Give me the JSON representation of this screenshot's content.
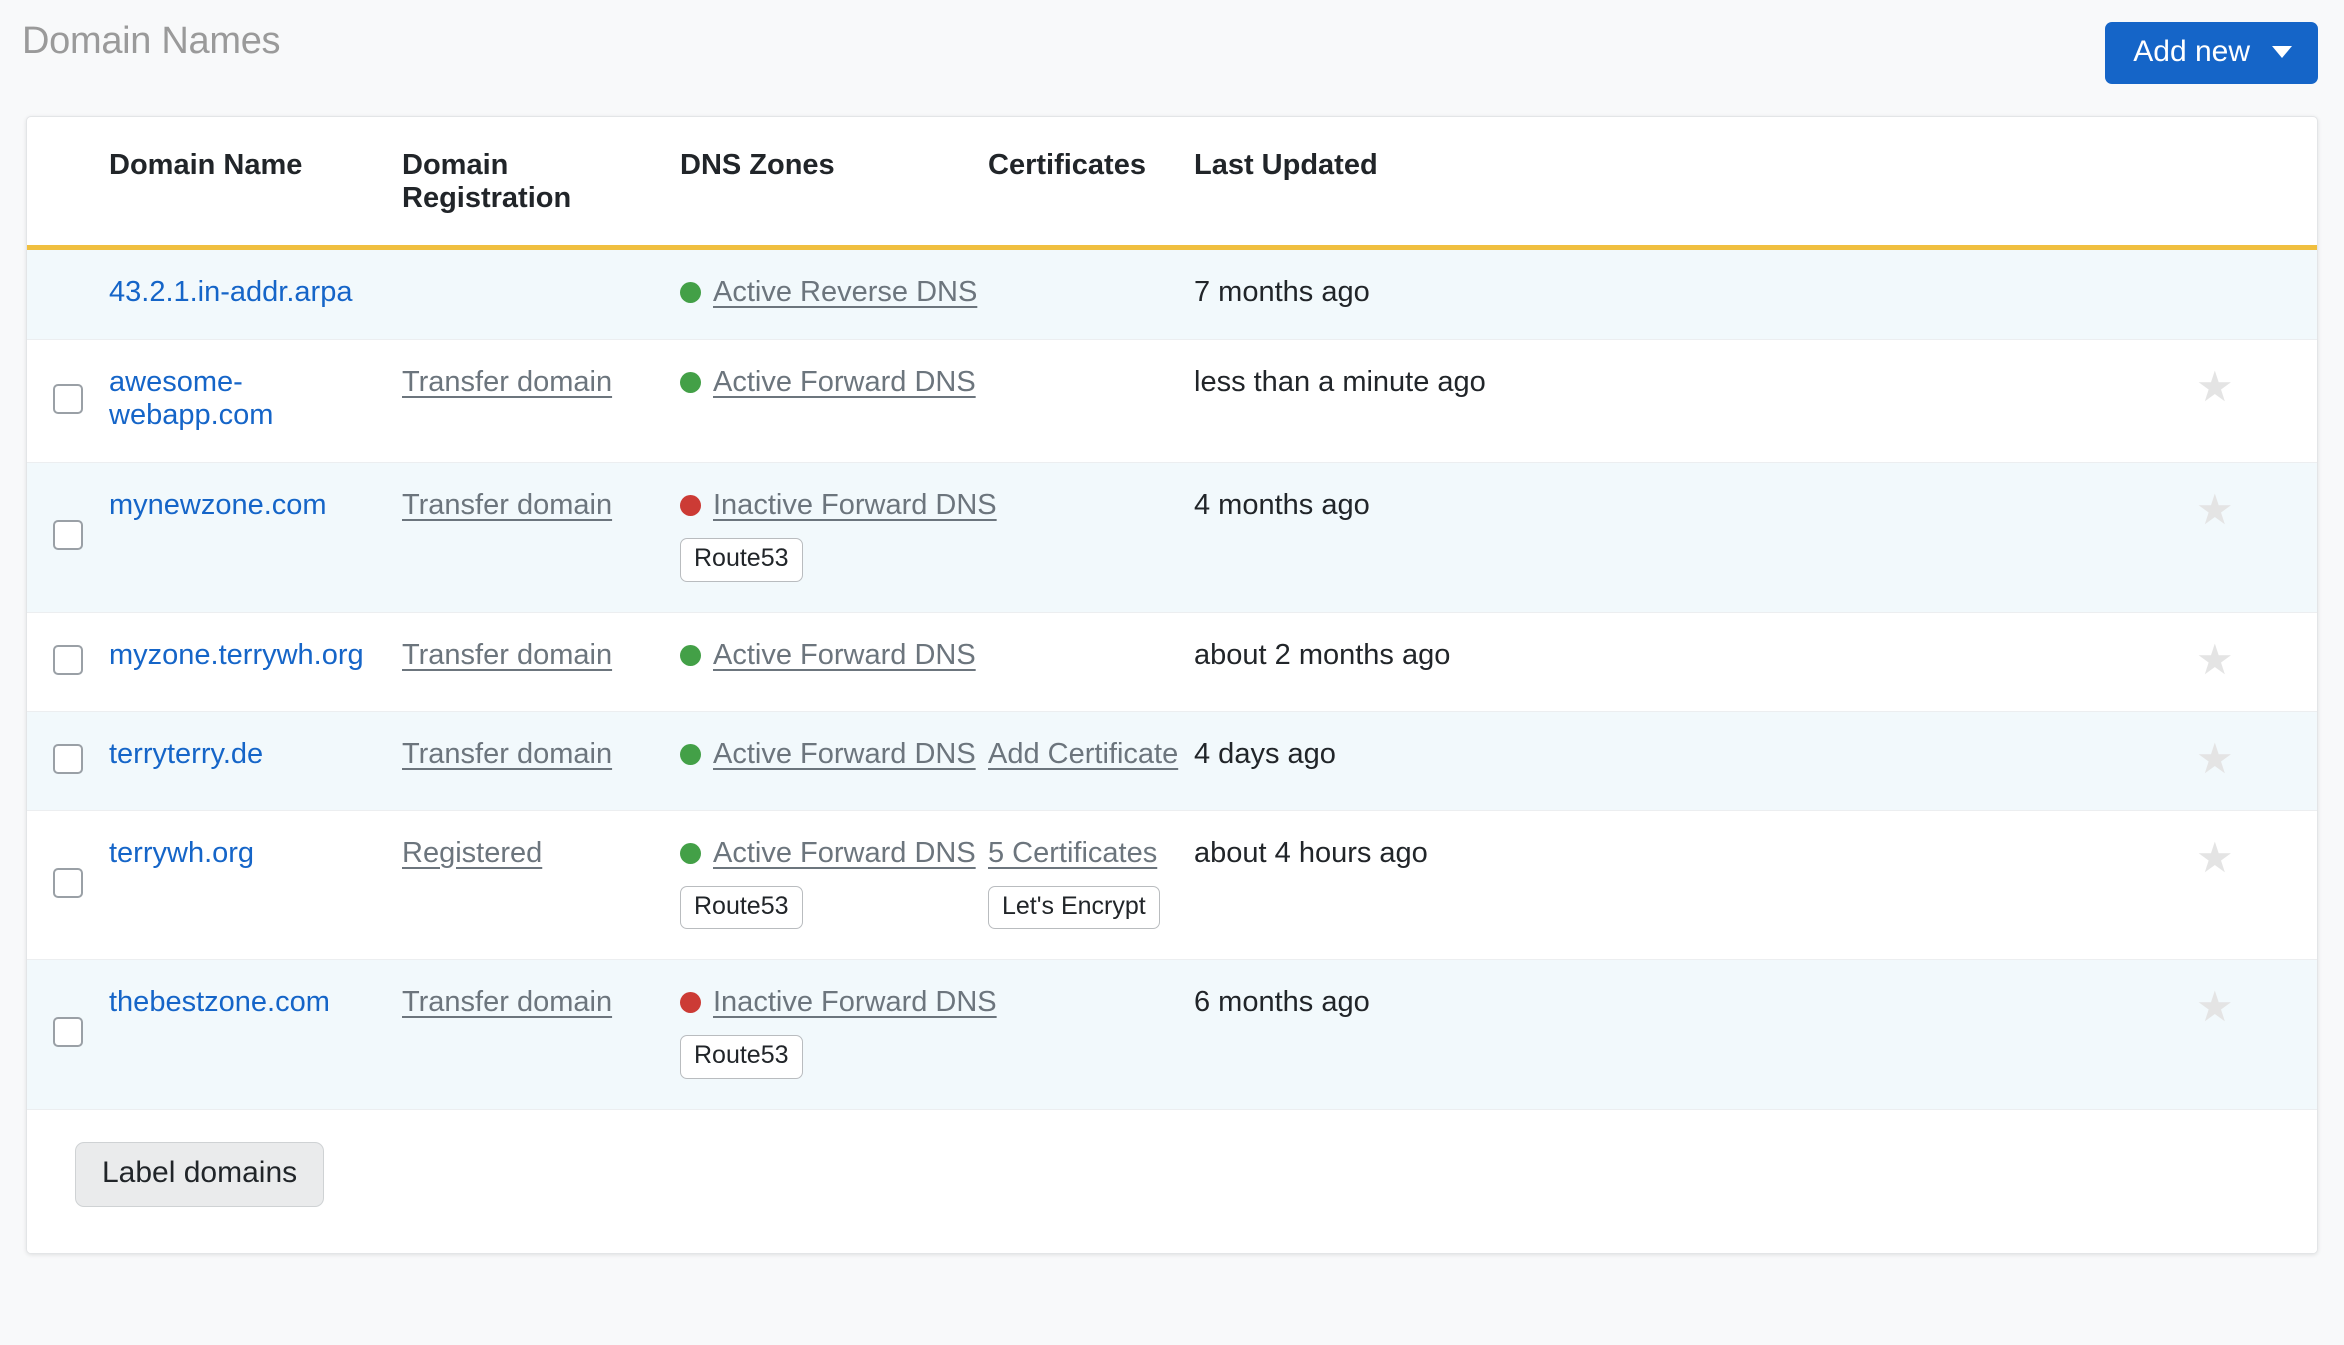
{
  "header": {
    "title": "Domain Names",
    "add_new_label": "Add new",
    "caret_icon": "chevron-down-icon"
  },
  "table": {
    "columns": [
      "",
      "Domain Name",
      "Domain Registration",
      "DNS Zones",
      "Certificates",
      "Last Updated",
      ""
    ],
    "header_accent_color": "#f0bf3f",
    "rows": [
      {
        "has_checkbox": false,
        "domain": "43.2.1.in-addr.arpa",
        "registration": "",
        "dns_status": "Active Reverse DNS",
        "dns_state": "active",
        "dns_badge": "",
        "certificates": "",
        "cert_badge": "",
        "last_updated": "7 months ago",
        "has_star": false
      },
      {
        "has_checkbox": true,
        "domain": "awesome-webapp.com",
        "registration": "Transfer domain",
        "dns_status": "Active Forward DNS",
        "dns_state": "active",
        "dns_badge": "",
        "certificates": "",
        "cert_badge": "",
        "last_updated": "less than a minute ago",
        "has_star": true
      },
      {
        "has_checkbox": true,
        "domain": "mynewzone.com",
        "registration": "Transfer domain",
        "dns_status": "Inactive Forward DNS",
        "dns_state": "inactive",
        "dns_badge": "Route53",
        "certificates": "",
        "cert_badge": "",
        "last_updated": "4 months ago",
        "has_star": true
      },
      {
        "has_checkbox": true,
        "domain": "myzone.terrywh.org",
        "registration": "Transfer domain",
        "dns_status": "Active Forward DNS",
        "dns_state": "active",
        "dns_badge": "",
        "certificates": "",
        "cert_badge": "",
        "last_updated": "about 2 months ago",
        "has_star": true
      },
      {
        "has_checkbox": true,
        "domain": "terryterry.de",
        "registration": "Transfer domain",
        "dns_status": "Active Forward DNS",
        "dns_state": "active",
        "dns_badge": "",
        "certificates": "Add Certificate",
        "cert_badge": "",
        "last_updated": "4 days ago",
        "has_star": true
      },
      {
        "has_checkbox": true,
        "domain": "terrywh.org",
        "registration": "Registered",
        "dns_status": "Active Forward DNS",
        "dns_state": "active",
        "dns_badge": "Route53",
        "certificates": "5 Certificates",
        "cert_badge": "Let's Encrypt",
        "last_updated": "about 4 hours ago",
        "has_star": true
      },
      {
        "has_checkbox": true,
        "domain": "thebestzone.com",
        "registration": "Transfer domain",
        "dns_status": "Inactive Forward DNS",
        "dns_state": "inactive",
        "dns_badge": "Route53",
        "certificates": "",
        "cert_badge": "",
        "last_updated": "6 months ago",
        "has_star": true
      }
    ]
  },
  "footer": {
    "label_domains_label": "Label domains"
  },
  "colors": {
    "primary": "#1565c8",
    "accent": "#f0bf3f",
    "active": "#43a047",
    "inactive": "#cc3b35",
    "link": "#1565c8",
    "muted_link": "#6c757d",
    "row_alt": "#f2f9fc",
    "star": "#e4e4e4"
  },
  "icons": {
    "star": "★"
  }
}
